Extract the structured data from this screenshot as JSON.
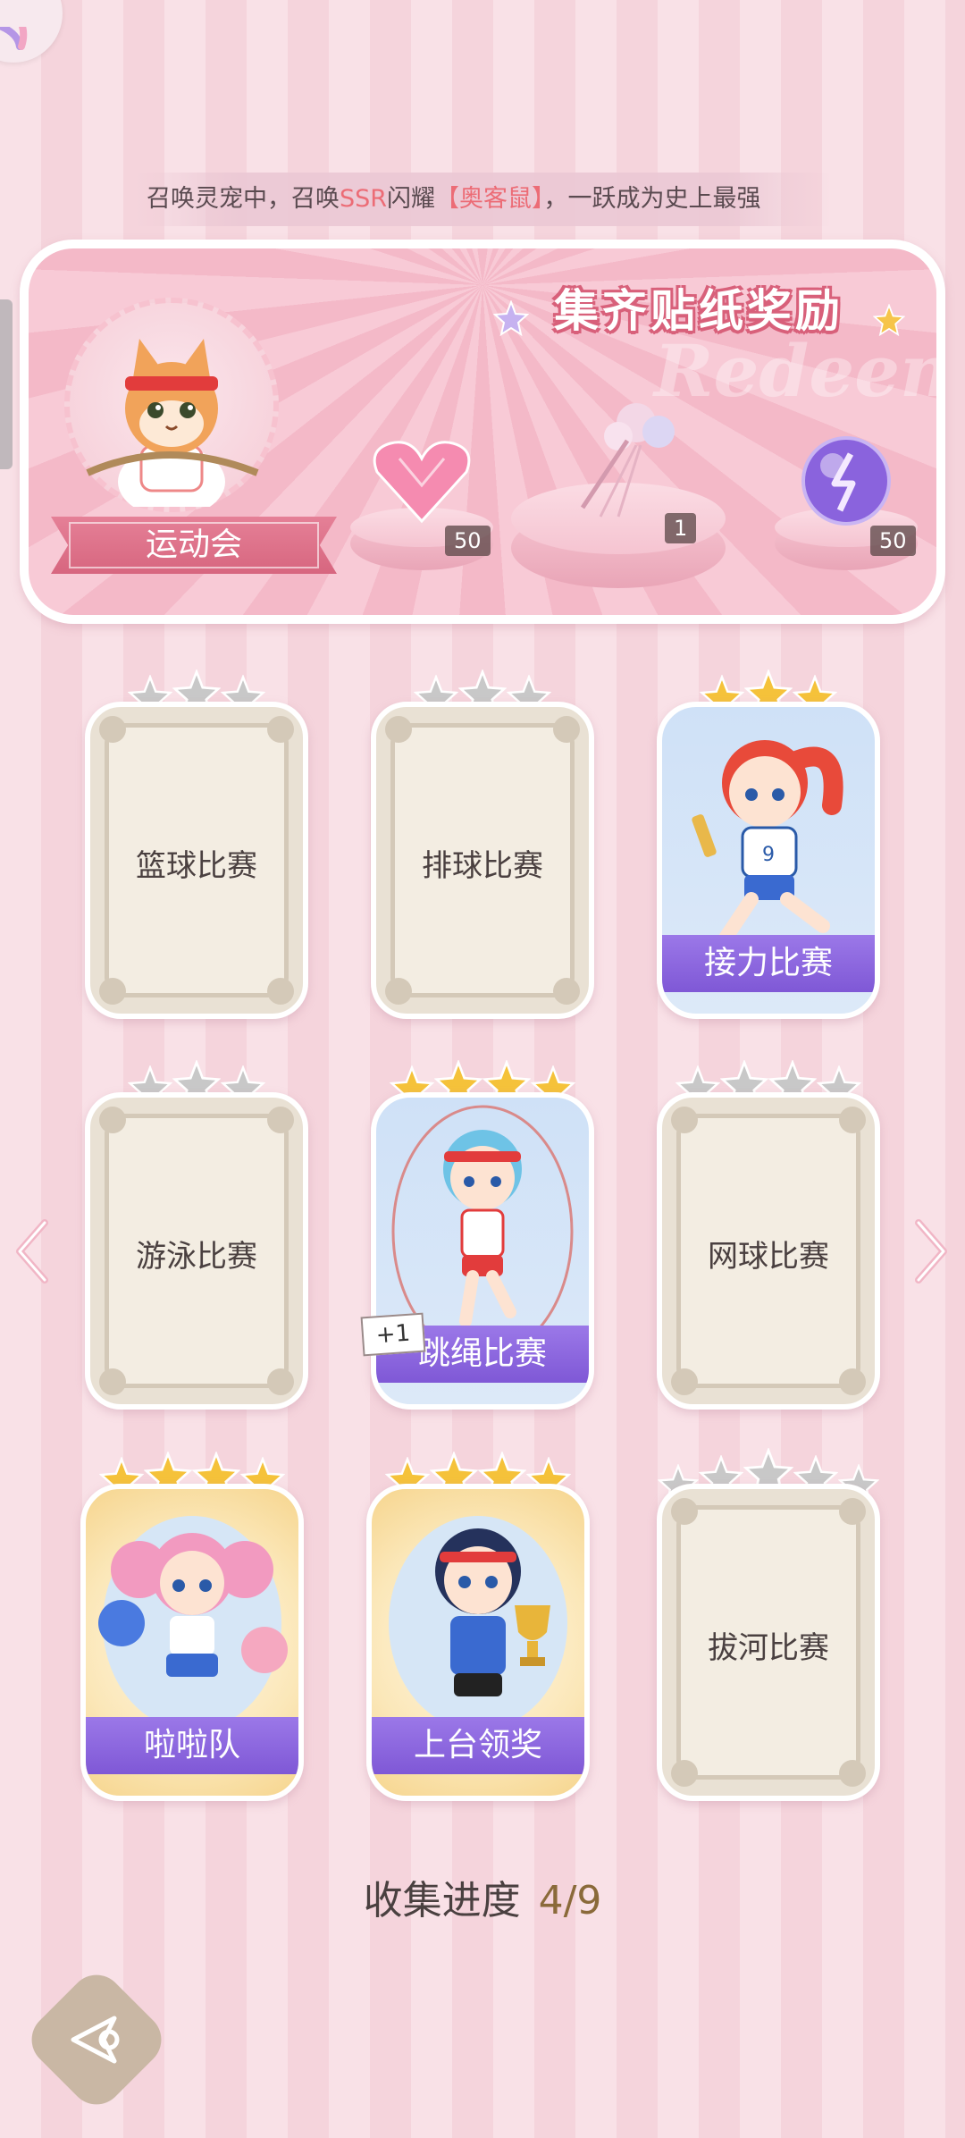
{
  "ticker": {
    "part1": "召唤灵宠中，召唤",
    "part2": "SSR",
    "part3": "闪耀",
    "part4": "【奥客鼠】",
    "part5": "，一跃成为史上最强"
  },
  "banner": {
    "title": "集齐贴纸奖励",
    "watermark": "Redeem",
    "event_label": "运动会",
    "rewards": [
      {
        "icon": "pink-heart-gem-icon",
        "count": "50"
      },
      {
        "icon": "flower-bouquet-icon",
        "count": "1"
      },
      {
        "icon": "purple-energy-orb-icon",
        "count": "50"
      }
    ]
  },
  "cards": [
    {
      "label": "篮球比赛",
      "unlocked": false,
      "stars": 3,
      "filled": 0
    },
    {
      "label": "排球比赛",
      "unlocked": false,
      "stars": 3,
      "filled": 0
    },
    {
      "label": "接力比赛",
      "unlocked": true,
      "stars": 3,
      "filled": 3
    },
    {
      "label": "游泳比赛",
      "unlocked": false,
      "stars": 3,
      "filled": 0
    },
    {
      "label": "跳绳比赛",
      "unlocked": true,
      "stars": 4,
      "filled": 4
    },
    {
      "label": "网球比赛",
      "unlocked": false,
      "stars": 4,
      "filled": 0
    },
    {
      "label": "啦啦队",
      "unlocked": true,
      "stars": 4,
      "filled": 4
    },
    {
      "label": "上台领奖",
      "unlocked": true,
      "stars": 4,
      "filled": 4
    },
    {
      "label": "拔河比赛",
      "unlocked": false,
      "stars": 5,
      "filled": 0
    }
  ],
  "new_badge": "+1",
  "progress": {
    "label": "收集进度",
    "value": "4/9"
  },
  "colors": {
    "accent_purple": "#8a63dd",
    "star_gold": "#f5c23a",
    "star_gray": "#c8c8c8"
  }
}
